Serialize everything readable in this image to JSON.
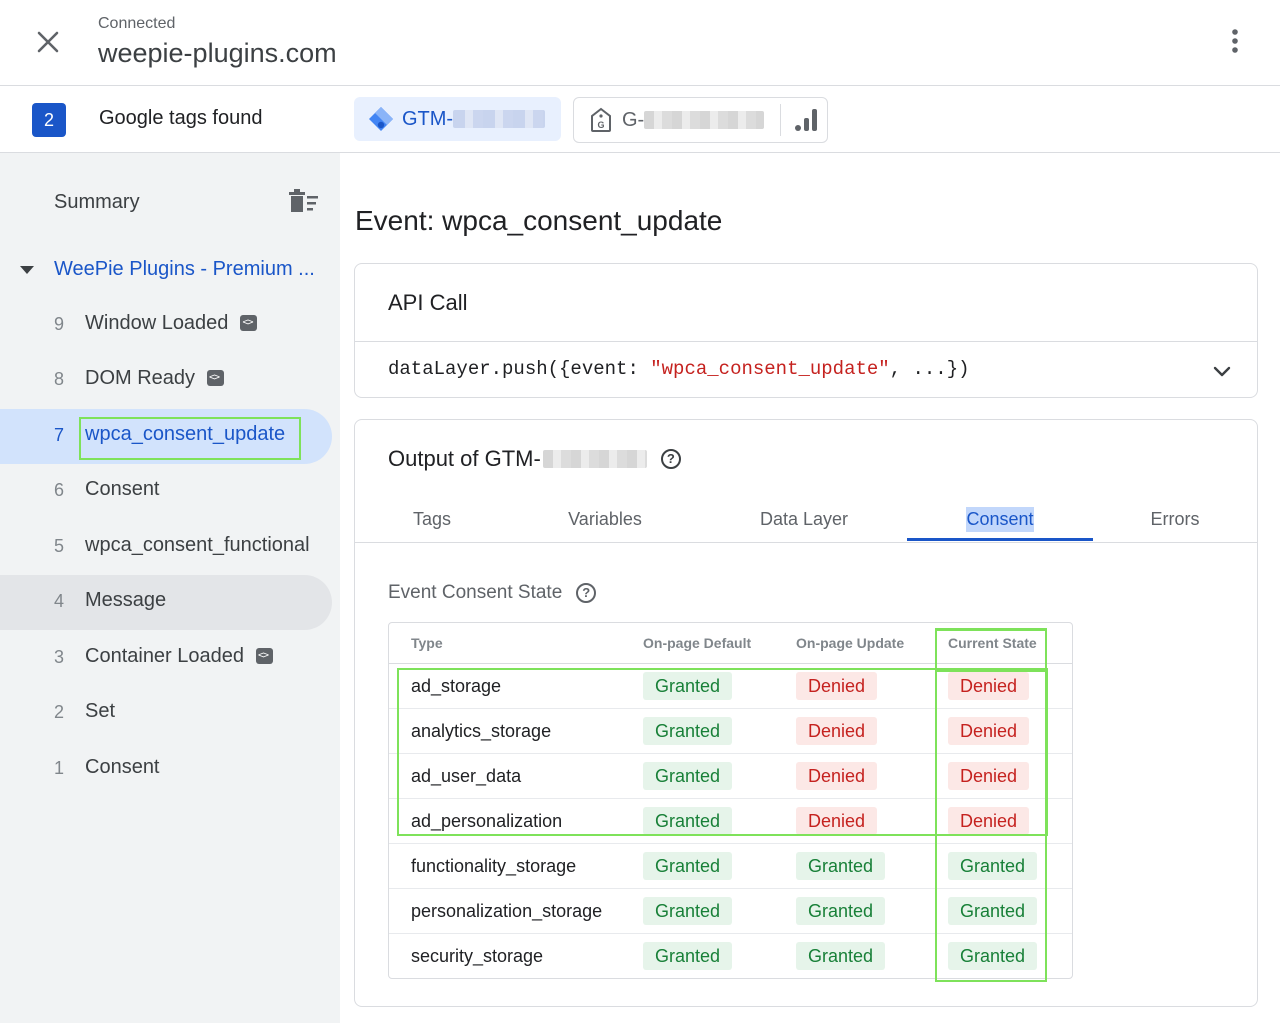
{
  "header": {
    "status": "Connected",
    "domain": "weepie-plugins.com",
    "close_icon": "close-icon",
    "menu_icon": "more-vert-icon"
  },
  "tags_bar": {
    "count": "2",
    "label": "Google tags found",
    "gtm_chip": {
      "prefix": "GTM-",
      "icon": "gtm-diamond-icon"
    },
    "ga_chip": {
      "prefix": "G-",
      "icon": "google-tag-icon",
      "analytics_icon": "analytics-bars-icon"
    }
  },
  "sidebar": {
    "summary_label": "Summary",
    "clear_icon": "delete-sweep-icon",
    "container_name": "WeePie Plugins - Premium ...",
    "events": [
      {
        "num": "9",
        "name": "Window Loaded",
        "has_code_icon": true
      },
      {
        "num": "8",
        "name": "DOM Ready",
        "has_code_icon": true
      },
      {
        "num": "7",
        "name": "wpca_consent_update",
        "has_code_icon": false,
        "selected": true
      },
      {
        "num": "6",
        "name": "Consent",
        "has_code_icon": false
      },
      {
        "num": "5",
        "name": "wpca_consent_functional",
        "has_code_icon": false
      },
      {
        "num": "4",
        "name": "Message",
        "has_code_icon": false
      },
      {
        "num": "3",
        "name": "Container Loaded",
        "has_code_icon": true
      },
      {
        "num": "2",
        "name": "Set",
        "has_code_icon": false
      },
      {
        "num": "1",
        "name": "Consent",
        "has_code_icon": false
      }
    ]
  },
  "main": {
    "event_title": "Event: wpca_consent_update",
    "api_card": {
      "title": "API Call",
      "code_prefix": "dataLayer.push({event: ",
      "code_string": "\"wpca_consent_update\"",
      "code_suffix": ", ...})"
    },
    "output_card": {
      "title_prefix": "Output of GTM-",
      "help": "?",
      "tabs": [
        "Tags",
        "Variables",
        "Data Layer",
        "Consent",
        "Errors"
      ],
      "active_tab": "Consent",
      "section_title": "Event Consent State",
      "table": {
        "headers": [
          "Type",
          "On-page Default",
          "On-page Update",
          "Current State"
        ],
        "rows": [
          [
            "ad_storage",
            "Granted",
            "Denied",
            "Denied"
          ],
          [
            "analytics_storage",
            "Granted",
            "Denied",
            "Denied"
          ],
          [
            "ad_user_data",
            "Granted",
            "Denied",
            "Denied"
          ],
          [
            "ad_personalization",
            "Granted",
            "Denied",
            "Denied"
          ],
          [
            "functionality_storage",
            "Granted",
            "Granted",
            "Granted"
          ],
          [
            "personalization_storage",
            "Granted",
            "Granted",
            "Granted"
          ],
          [
            "security_storage",
            "Granted",
            "Granted",
            "Granted"
          ]
        ]
      }
    }
  },
  "colors": {
    "accent": "#1a56c8",
    "highlight": "#7ee25a",
    "granted_bg": "#e6f4ea",
    "denied_bg": "#fce8e6"
  }
}
